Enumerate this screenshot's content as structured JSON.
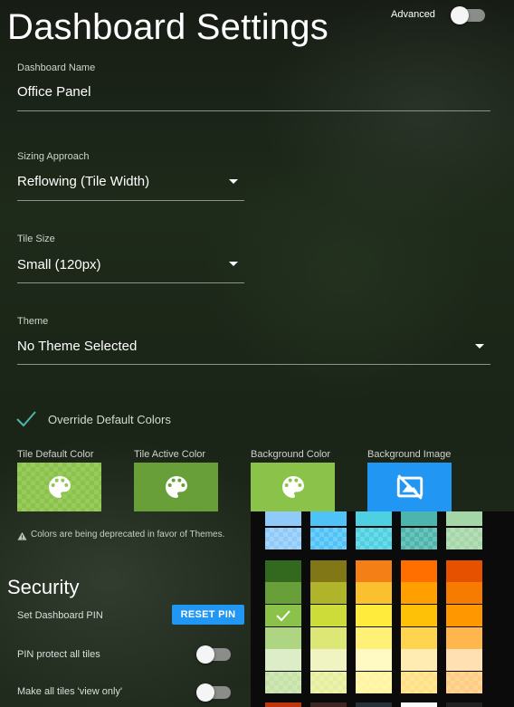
{
  "header": {
    "title": "Dashboard Settings",
    "advanced_label": "Advanced"
  },
  "fields": {
    "dashboard_name": {
      "label": "Dashboard Name",
      "value": "Office Panel"
    },
    "sizing": {
      "label": "Sizing Approach",
      "value": "Reflowing (Tile Width)"
    },
    "tile_size": {
      "label": "Tile Size",
      "value": "Small (120px)"
    },
    "theme": {
      "label": "Theme",
      "value": "No Theme Selected"
    }
  },
  "override": {
    "label": "Override Default Colors",
    "checked": true
  },
  "swatches": [
    {
      "label": "Tile Default Color",
      "color": "#8bc34a",
      "icon": "palette-icon"
    },
    {
      "label": "Tile Active Color",
      "color": "#689f38",
      "icon": "palette-icon"
    },
    {
      "label": "Background Color",
      "color": "#8bc34a",
      "icon": "palette-icon"
    },
    {
      "label": "Background Image",
      "color": "#2196f3",
      "icon": "no-image-icon"
    }
  ],
  "note": "Colors are being deprecated in favor of Themes.",
  "security": {
    "title": "Security",
    "pin_label": "Set Dashboard PIN",
    "reset_button": "RESET PIN",
    "protect_label": "PIN protect all tiles",
    "view_only_label": "Make all tiles 'view only'"
  },
  "palette": {
    "top_row": [
      "#90caf9",
      "#4fc3f7",
      "#4dd0e1",
      "#4db6ac",
      "#a5d6a7"
    ],
    "columns": [
      [
        "#33691e",
        "#689f38",
        "#8bc34a",
        "#aed581",
        "#dcedc8",
        "#c5e1a5"
      ],
      [
        "#827717",
        "#afb42b",
        "#cddc39",
        "#dce775",
        "#f0f4c3",
        "#e6ee9c"
      ],
      [
        "#f57f17",
        "#fbc02d",
        "#ffeb3b",
        "#fff176",
        "#fff9c4",
        "#fff59d"
      ],
      [
        "#ff6f00",
        "#ffa000",
        "#ffc107",
        "#ffd54f",
        "#ffecb3",
        "#ffe082"
      ],
      [
        "#e65100",
        "#f57c00",
        "#ff9800",
        "#ffb74d",
        "#ffe0b2",
        "#ffcc80"
      ]
    ],
    "selected": "#8bc34a"
  },
  "colors": {
    "accent": "#2196f3",
    "check": "#4db6ac"
  }
}
